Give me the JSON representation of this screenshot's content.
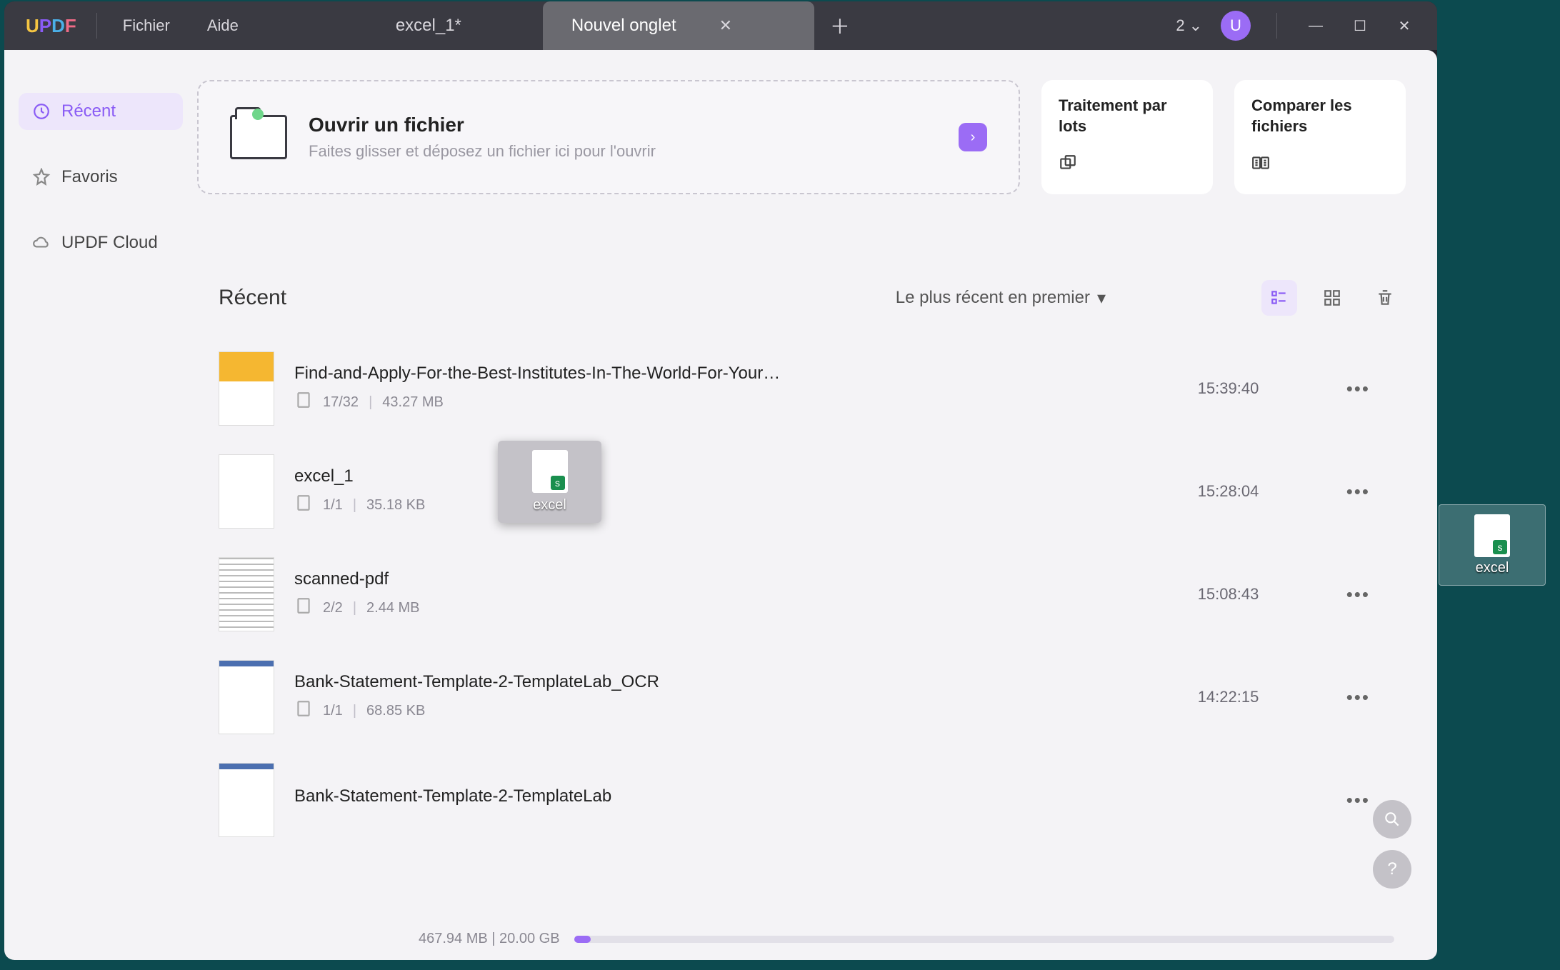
{
  "logo": "UPDF",
  "menus": {
    "file": "Fichier",
    "help": "Aide"
  },
  "tabs": {
    "inactive": "excel_1*",
    "active": "Nouvel onglet",
    "count": "2"
  },
  "avatar": "U",
  "sidebar": {
    "recent": "Récent",
    "favorites": "Favoris",
    "cloud": "UPDF Cloud"
  },
  "open": {
    "title": "Ouvrir un fichier",
    "hint": "Faites glisser et déposez un fichier ici pour l'ouvrir"
  },
  "actions": {
    "batch": "Traitement par lots",
    "compare": "Comparer les fichiers"
  },
  "recent": {
    "heading": "Récent",
    "sort": "Le plus récent en premier"
  },
  "files": [
    {
      "name": "Find-and-Apply-For-the-Best-Institutes-In-The-World-For-Your…",
      "pages": "17/32",
      "size": "43.27 MB",
      "time": "15:39:40",
      "thumb": "find-thumb"
    },
    {
      "name": "excel_1",
      "pages": "1/1",
      "size": "35.18 KB",
      "time": "15:28:04",
      "thumb": ""
    },
    {
      "name": "scanned-pdf",
      "pages": "2/2",
      "size": "2.44 MB",
      "time": "15:08:43",
      "thumb": "scan-thumb"
    },
    {
      "name": "Bank-Statement-Template-2-TemplateLab_OCR",
      "pages": "1/1",
      "size": "68.85 KB",
      "time": "14:22:15",
      "thumb": "bank-thumb"
    },
    {
      "name": "Bank-Statement-Template-2-TemplateLab",
      "pages": "",
      "size": "",
      "time": "",
      "thumb": "bank-thumb"
    }
  ],
  "storage": {
    "used": "467.94 MB",
    "total": "20.00 GB"
  },
  "drag": {
    "label": "excel"
  },
  "desktop": {
    "label": "excel"
  }
}
